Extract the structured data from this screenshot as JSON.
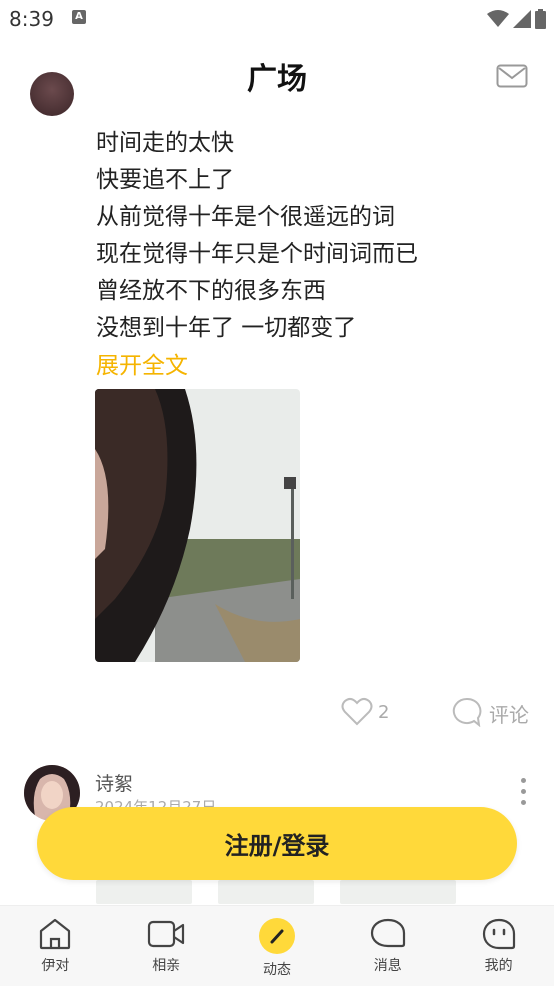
{
  "status_bar": {
    "time": "8:39",
    "notification_icon": "A"
  },
  "header": {
    "title": "广场",
    "mail_icon": "mail-icon"
  },
  "post1": {
    "lines": [
      "时间走的太快",
      "快要追不上了",
      "从前觉得十年是个很遥远的词",
      "现在觉得十年只是个时间词而已",
      "曾经放不下的很多东西",
      "没想到十年了 一切都变了"
    ],
    "expand_label": "展开全文",
    "like_count": "2",
    "comment_label": "评论"
  },
  "post2": {
    "username": "诗絮",
    "date": "2024年12月27日"
  },
  "login_button": "注册/登录",
  "tabs": [
    {
      "label": "伊对",
      "icon": "home-icon"
    },
    {
      "label": "相亲",
      "icon": "video-icon"
    },
    {
      "label": "动态",
      "icon": "pen-icon"
    },
    {
      "label": "消息",
      "icon": "message-icon"
    },
    {
      "label": "我的",
      "icon": "profile-icon"
    }
  ],
  "colors": {
    "accent": "#ffd93a",
    "expand_text": "#f5b400"
  }
}
